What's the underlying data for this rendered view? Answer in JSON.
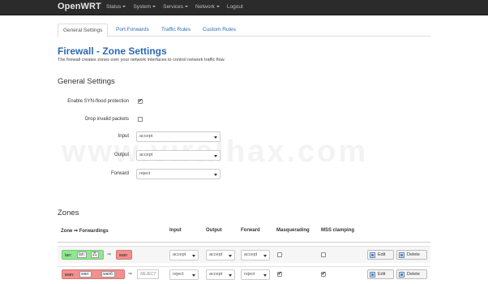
{
  "navbar": {
    "brand": "OpenWRT",
    "menu": [
      "Status",
      "System",
      "Services",
      "Network",
      "Logout"
    ]
  },
  "tabs": [
    "General Settings",
    "Port Forwards",
    "Traffic Rules",
    "Custom Rules"
  ],
  "page": {
    "title": "Firewall - Zone Settings",
    "description": "The firewall creates zones over your network interfaces to control network traffic flow."
  },
  "general": {
    "title": "General Settings",
    "syn_flood_label": "Enable SYN-flood protection",
    "syn_flood_checked": true,
    "drop_invalid_label": "Drop invalid packets",
    "drop_invalid_checked": false,
    "input_label": "Input",
    "input_value": "accept",
    "output_label": "Output",
    "output_value": "accept",
    "forward_label": "Forward",
    "forward_value": "reject"
  },
  "watermark": "www.viralhax.com",
  "zones": {
    "title": "Zones",
    "headers": [
      "Zone ⇒ Forwardings",
      "Input",
      "Output",
      "Forward",
      "Masquerading",
      "MSS clamping"
    ],
    "rows": [
      {
        "zone": "lan:",
        "chips": [
          "lan:",
          "🖧"
        ],
        "target": "wan",
        "input": "accept",
        "output": "accept",
        "forward": "accept",
        "masquerading": false,
        "mss_clamping": false,
        "edit": "Edit",
        "delete": "Delete"
      },
      {
        "zone": "wan:",
        "chips": [
          "wan:",
          "wan6:"
        ],
        "target": "REJECT",
        "input": "reject",
        "output": "accept",
        "forward": "reject",
        "masquerading": true,
        "mss_clamping": true,
        "edit": "Edit",
        "delete": "Delete"
      }
    ]
  }
}
